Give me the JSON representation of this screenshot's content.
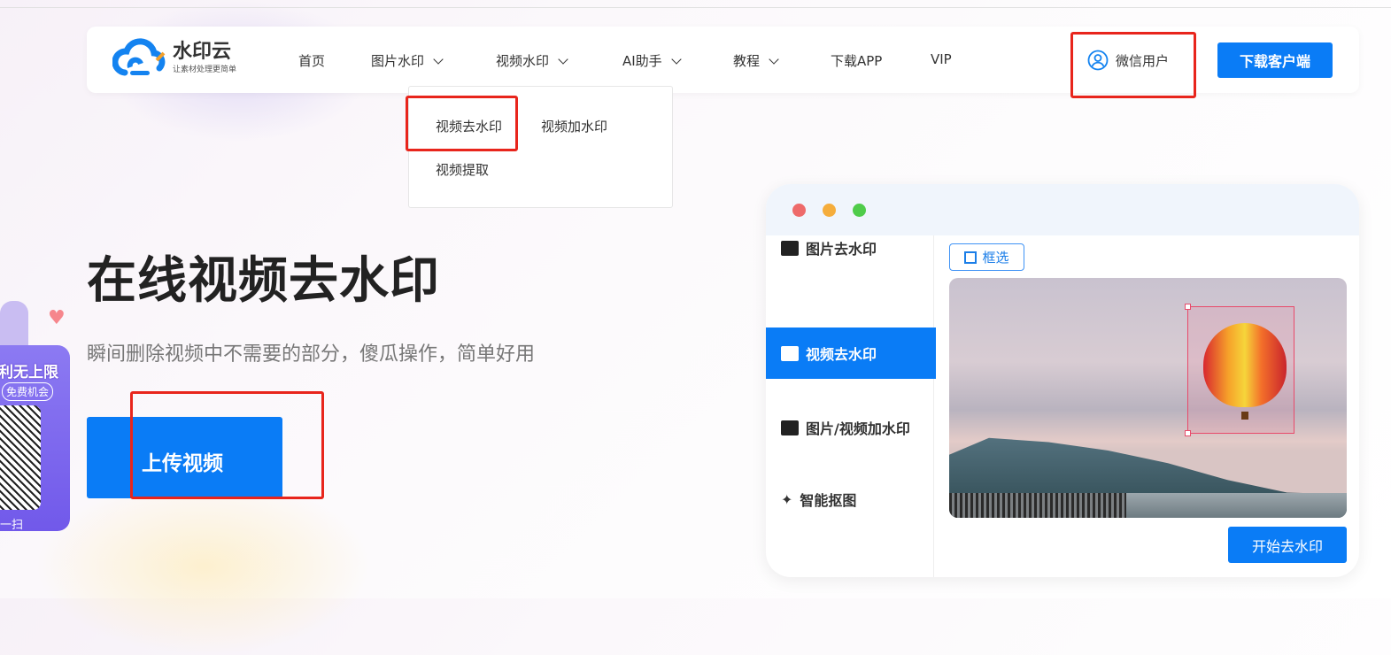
{
  "logo": {
    "name": "水印云",
    "slogan": "让素材处理更简单"
  },
  "nav": {
    "items": [
      {
        "label": "首页"
      },
      {
        "label": "图片水印"
      },
      {
        "label": "视频水印"
      },
      {
        "label": "AI助手"
      },
      {
        "label": "教程"
      },
      {
        "label": "下载APP"
      },
      {
        "label": "VIP"
      }
    ],
    "user": "微信用户",
    "download": "下载客户端"
  },
  "dropdown": {
    "items": [
      "视频去水印",
      "视频加水印",
      "视频提取"
    ]
  },
  "hero": {
    "title": "在线视频去水印",
    "subtitle": "瞬间删除视频中不需要的部分，傻瓜操作，简单好用",
    "upload": "上传视频"
  },
  "promo": {
    "line1": "利无上限",
    "line2": "免费机会",
    "line3": "一扫"
  },
  "mock": {
    "sidebar": [
      "图片去水印",
      "视频去水印",
      "图片/视频加水印",
      "智能抠图"
    ],
    "select": "框选",
    "start": "开始去水印"
  },
  "colors": {
    "accent": "#0a7cf6",
    "highlight": "#e8251c"
  }
}
